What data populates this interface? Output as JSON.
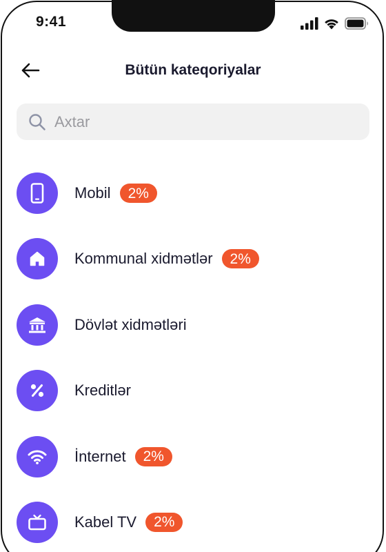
{
  "status_bar": {
    "time": "9:41"
  },
  "header": {
    "title": "Bütün kateqoriyalar"
  },
  "search": {
    "placeholder": "Axtar",
    "value": ""
  },
  "categories": [
    {
      "label": "Mobil",
      "badge": "2%",
      "icon": "mobile-phone-icon"
    },
    {
      "label": "Kommunal xidmətlər",
      "badge": "2%",
      "icon": "house-icon"
    },
    {
      "label": "Dövlət xidmətləri",
      "badge": "",
      "icon": "bank-building-icon"
    },
    {
      "label": "Kreditlər",
      "badge": "",
      "icon": "percent-icon"
    },
    {
      "label": "İnternet",
      "badge": "2%",
      "icon": "wifi-icon"
    },
    {
      "label": "Kabel TV",
      "badge": "2%",
      "icon": "tv-icon"
    }
  ],
  "colors": {
    "accent": "#6c4ef2",
    "badge": "#f0562d",
    "search_bg": "#f1f1f1"
  }
}
